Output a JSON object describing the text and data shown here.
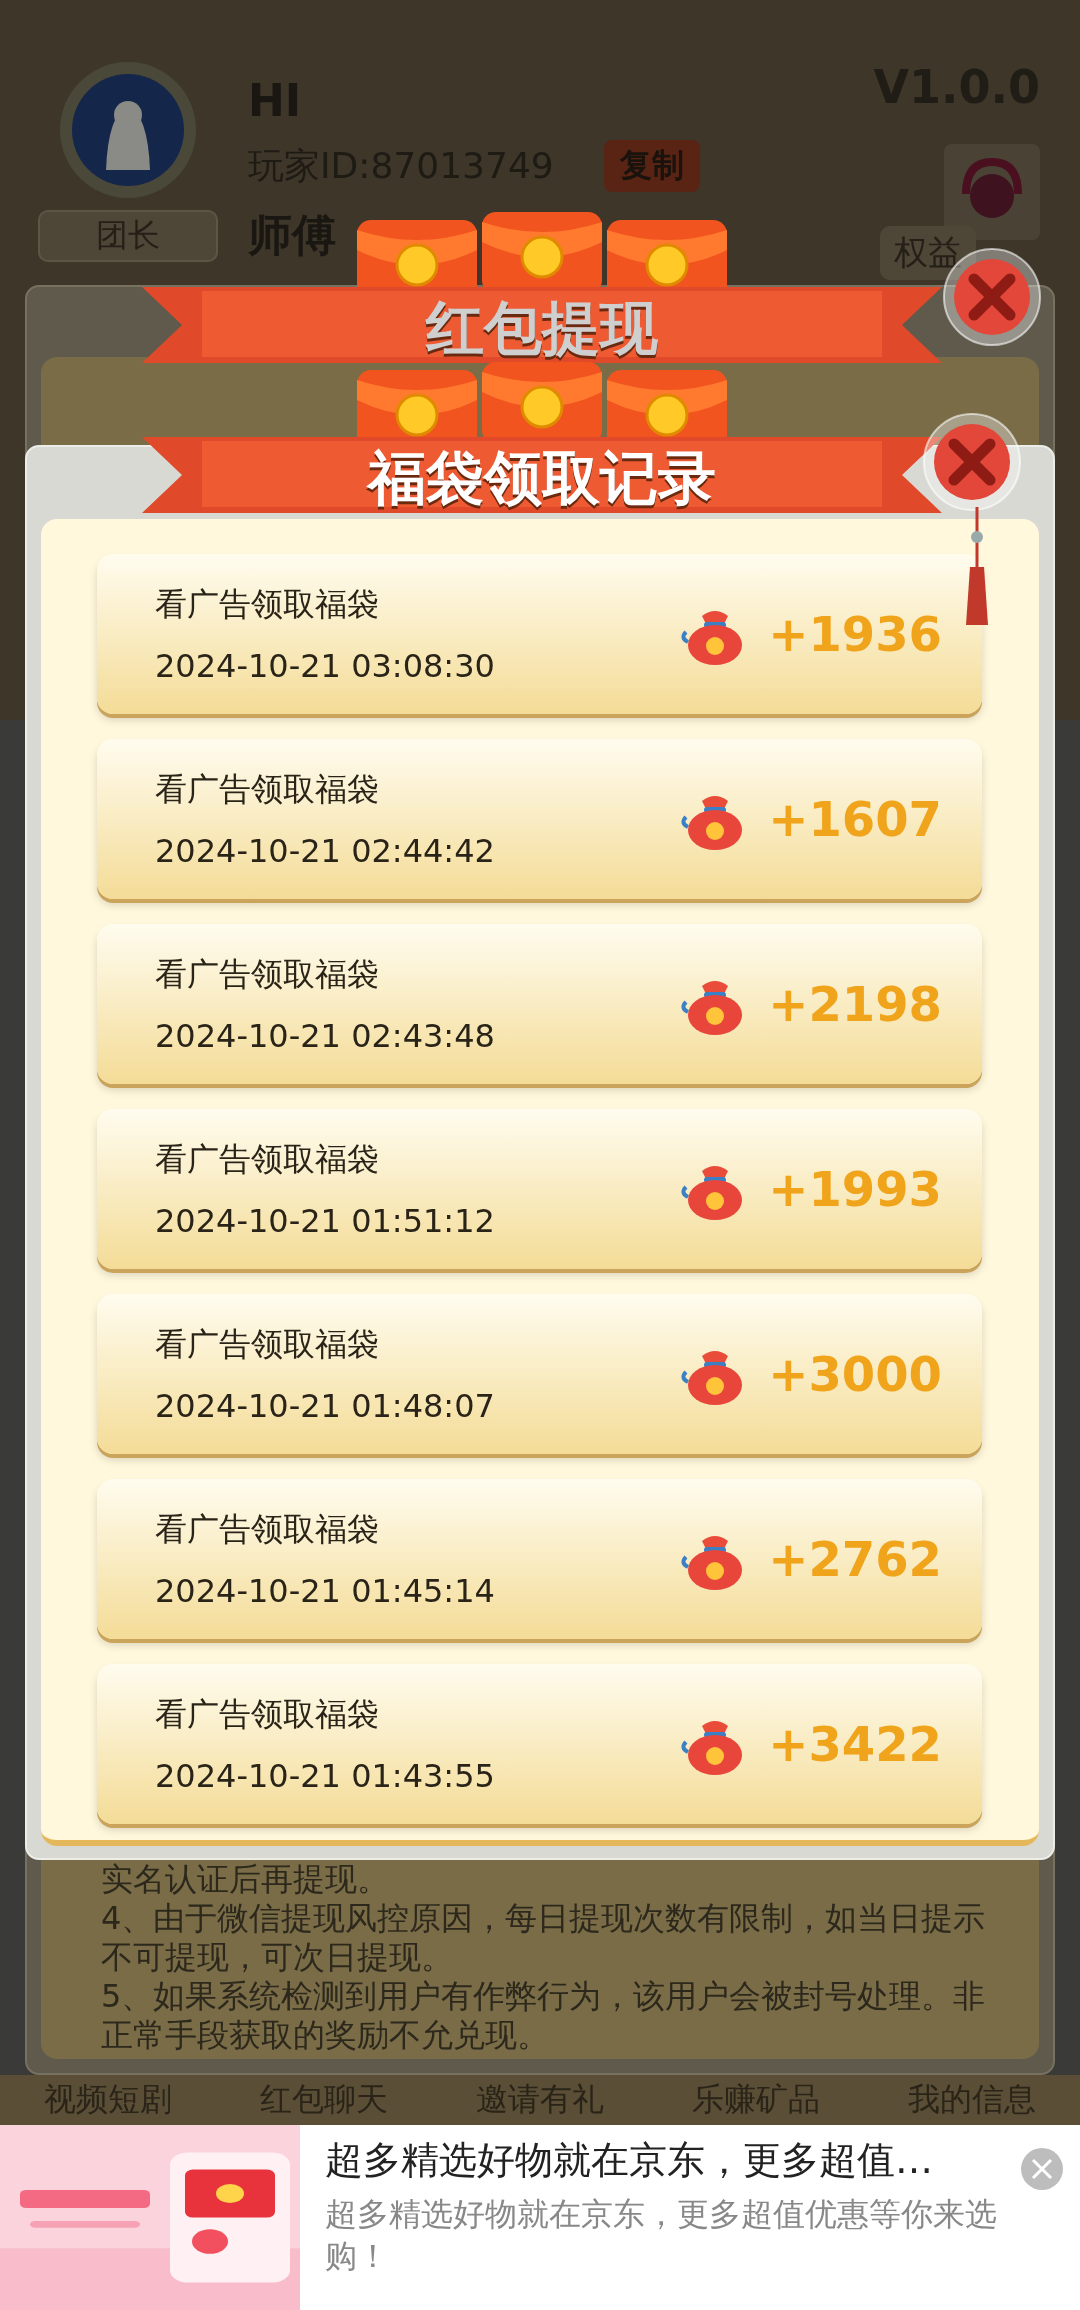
{
  "header": {
    "greeting": "HI",
    "player_id": "玩家ID:87013749",
    "copy_button": "复制",
    "master": "师傅",
    "role_button": "团长",
    "version": "V1.0.0",
    "rights_button": "权益"
  },
  "withdraw_dialog": {
    "title": "红包提现",
    "rules": [
      "实名认证后再提现。",
      "4、由于微信提现风控原因，每日提现次数有限制，如当日提示不可提现，可次日提现。",
      "5、如果系统检测到用户有作弊行为，该用户会被封号处理。非正常手段获取的奖励不允兑现。"
    ]
  },
  "nav": [
    "视频短剧",
    "红包聊天",
    "邀请有礼",
    "乐赚矿品",
    "我的信息"
  ],
  "record_dialog": {
    "title": "福袋领取记录",
    "records": [
      {
        "title": "看广告领取福袋",
        "time": "2024-10-21 03:08:30",
        "amount": "+1936"
      },
      {
        "title": "看广告领取福袋",
        "time": "2024-10-21 02:44:42",
        "amount": "+1607"
      },
      {
        "title": "看广告领取福袋",
        "time": "2024-10-21 02:43:48",
        "amount": "+2198"
      },
      {
        "title": "看广告领取福袋",
        "time": "2024-10-21 01:51:12",
        "amount": "+1993"
      },
      {
        "title": "看广告领取福袋",
        "time": "2024-10-21 01:48:07",
        "amount": "+3000"
      },
      {
        "title": "看广告领取福袋",
        "time": "2024-10-21 01:45:14",
        "amount": "+2762"
      },
      {
        "title": "看广告领取福袋",
        "time": "2024-10-21 01:43:55",
        "amount": "+3422"
      }
    ]
  },
  "ad": {
    "headline": "超多精选好物就在京东，更多超值…",
    "description": "超多精选好物就在京东，更多超值优惠等你来选购！"
  }
}
